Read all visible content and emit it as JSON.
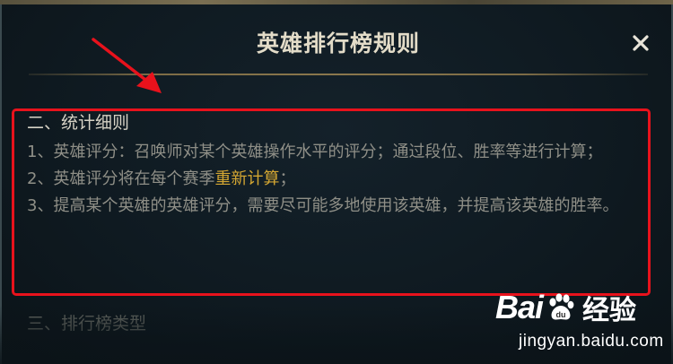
{
  "modal": {
    "title": "英雄排行榜规则",
    "close_label": "×"
  },
  "content": {
    "section2_heading": "二、统计细则",
    "rule1": "1、英雄评分：召唤师对某个英雄操作水平的评分；通过段位、胜率等进行计算；",
    "rule2_before": "2、英雄评分将在每个赛季",
    "rule2_highlight": "重新计算",
    "rule2_after": "；",
    "rule3": "3、提高某个英雄的英雄评分，需要尽可能多地使用该英雄，并提高该英雄的胜率。",
    "section3_heading": "三、排行榜类型"
  },
  "watermark": {
    "logo_text_1": "Bai",
    "logo_text_2": "du",
    "logo_text_3": "经验",
    "url": "jingyan.baidu.com"
  },
  "colors": {
    "background": "#0f1a21",
    "title": "#e3dcc8",
    "heading": "#d6d2c5",
    "body_text": "#8f8f87",
    "highlight": "#d3a632",
    "annotation_red": "#e8121c",
    "divider_gold": "#8a774c"
  }
}
